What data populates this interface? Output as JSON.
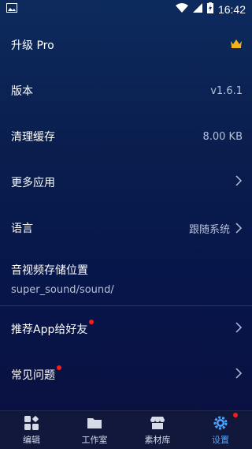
{
  "status": {
    "time": "16:42"
  },
  "settings": {
    "upgrade": {
      "label": "升级 Pro"
    },
    "version": {
      "label": "版本",
      "value": "v1.6.1"
    },
    "cache": {
      "label": "清理缓存",
      "value": "8.00 KB"
    },
    "more_apps": {
      "label": "更多应用"
    },
    "language": {
      "label": "语言",
      "value": "跟随系统"
    },
    "storage": {
      "label": "音视频存储位置",
      "path": "super_sound/sound/"
    },
    "recommend": {
      "label": "推荐App给好友"
    },
    "faq": {
      "label": "常见问题"
    }
  },
  "nav": {
    "edit": "编辑",
    "studio": "工作室",
    "library": "素材库",
    "settings": "设置"
  },
  "colors": {
    "accent": "#4aa3ff",
    "badge": "#ff1a1a",
    "crown": "#f2b21b"
  }
}
